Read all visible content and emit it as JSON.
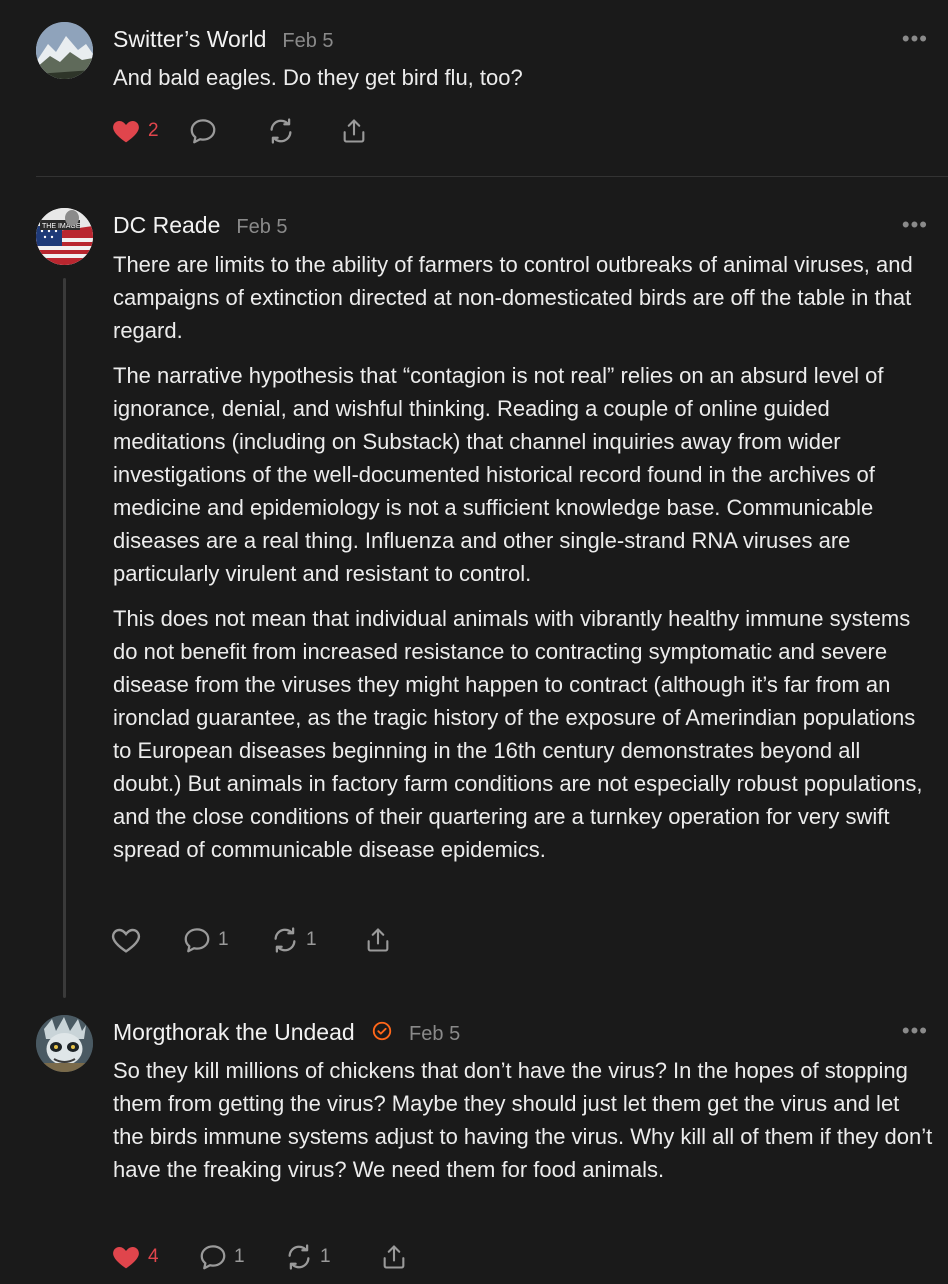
{
  "comments": [
    {
      "author": "Switter’s World",
      "date": "Feb 5",
      "paragraphs": [
        "And bald eagles. Do they get bird flu, too?"
      ],
      "likes": "2",
      "replies": "",
      "restacks": "",
      "liked": true,
      "avatar": "mountain-avatar"
    },
    {
      "author": "DC Reade",
      "date": "Feb 5",
      "paragraphs": [
        "There are limits to the ability of farmers to control outbreaks of animal viruses, and campaigns of extinction directed at non-domesticated birds are off the table in that regard.",
        "The narrative hypothesis that “contagion is not real” relies on an absurd level of ignorance, denial, and wishful thinking. Reading a couple of online guided meditations (including on Substack) that channel inquiries away from wider investigations of the well-documented historical record found in the archives of medicine and epidemiology is not a sufficient knowledge base. Communicable diseases are a real thing. Influenza and other single-strand RNA viruses are particularly virulent and resistant to control.",
        "This does not mean that individual animals with vibrantly healthy immune systems do not benefit from increased resistance to contracting symptomatic and severe disease from the viruses they might happen to contract (although it’s far from an ironclad guarantee, as the tragic history of the exposure of Amerindian populations to European diseases beginning in the 16th century demonstrates beyond all doubt.) But animals in factory farm conditions are not especially robust populations, and the close conditions of their quartering are a turnkey operation for very swift spread of communicable disease epidemics."
      ],
      "likes": "",
      "replies": "1",
      "restacks": "1",
      "liked": false,
      "avatar": "the-image-avatar",
      "avatar_text": "THE IMAGE"
    },
    {
      "author": "Morgthorak the Undead",
      "date": "Feb 5",
      "paragraphs": [
        "So they kill millions of chickens that don’t have the virus? In the hopes of stopping them from getting the virus? Maybe they should just let them get the virus and let the birds immune systems adjust to having the virus. Why kill all of them if they don’t have the freaking virus? We need them for food animals."
      ],
      "likes": "4",
      "replies": "1",
      "restacks": "1",
      "liked": true,
      "verified": true,
      "avatar": "creature-avatar"
    }
  ],
  "more_label": "•••",
  "colors": {
    "background": "#1a1a1a",
    "like_red": "#e0454c",
    "verified_orange": "#ff6719",
    "muted": "#8a8a8a"
  }
}
